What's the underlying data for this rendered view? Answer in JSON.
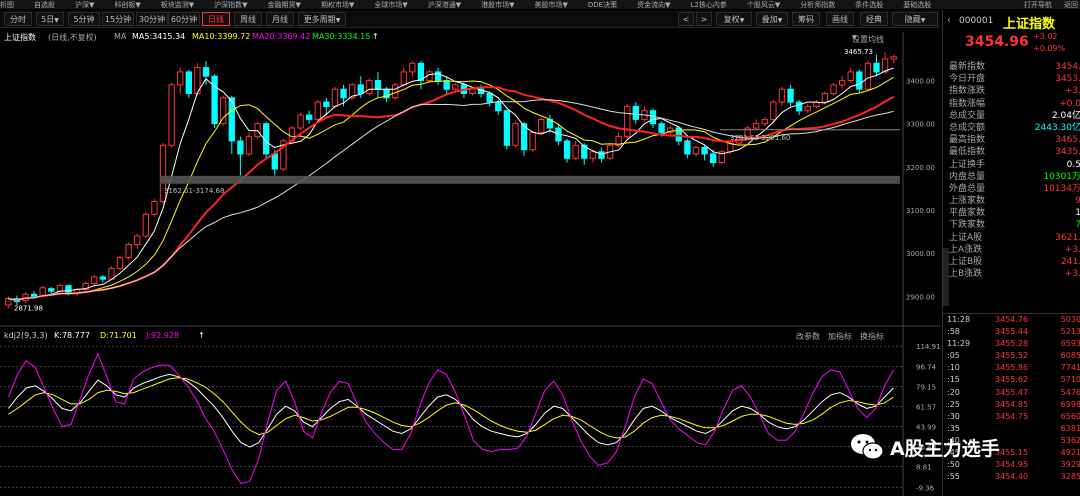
{
  "topbar": {
    "items": [
      "析图",
      "自选股",
      "沪深▼",
      "科创板▼",
      "板块监测▼",
      "沪深指数▼",
      "金融期货▼",
      "期权市场▼",
      "全球市场▼",
      "沪深港通▼",
      "港股市场▼",
      "美股市场▼",
      "DDE决策",
      "资金流向▼",
      "L2核心内参",
      "个股风云▼",
      "分析师指数",
      "条件选股",
      "基础选股"
    ],
    "right": [
      "打开导航",
      "返回"
    ]
  },
  "tabs": [
    "分时",
    "5日",
    "5分钟",
    "15分钟",
    "30分钟",
    "60分钟",
    "日线",
    "周线",
    "月线",
    "更多周期"
  ],
  "toolbar": {
    "nav_left": "<",
    "nav_right": ">",
    "restore": "复权",
    "overlay": "叠加",
    "chips": "筹码",
    "draw": "画线",
    "classic": "经典",
    "hide": "隐藏"
  },
  "panel_header": {
    "code": "000001",
    "name": "上证指数"
  },
  "quote": {
    "price": "3454.96",
    "change": "+3.02",
    "change_pct": "+0.09%"
  },
  "ma_info": {
    "name": "上证指数",
    "mode": "(日线,不复权)",
    "ma_label": "MA",
    "ma5": "MA5:3415.34",
    "ma10": "MA10:3399.72",
    "ma20": "MA20:3369.42",
    "ma30": "MA30:3334.15",
    "settings": "设置均线"
  },
  "kdj_info": {
    "name": "kdj2(9,3,3)",
    "k": "K:78.777",
    "d": "D:71.701",
    "j": "J:92.928",
    "change_params": "改参数",
    "add_indicator": "加指标",
    "switch_indicator": "换指标"
  },
  "colors": {
    "up": "#ff3333",
    "down": "#00ffff",
    "ma5": "#ffffff",
    "ma10": "#ffff00",
    "ma20": "#ff00ff",
    "ma30": "#00ff00",
    "k": "#ffffff",
    "d": "#ffff00",
    "j": "#ff00ff"
  },
  "chart_data": [
    {
      "type": "candlestick",
      "title": "上证指数",
      "y_ticks": [
        "3400.00",
        "3300.00",
        "3200.00",
        "3100.00",
        "3000.00",
        "2900.00"
      ],
      "ylim": [
        2850,
        3480
      ],
      "annotations": {
        "high": "3465.73",
        "low": "2871.98",
        "support_1": "3162.61-3174.68",
        "support_2": "3281.62-3291.60"
      },
      "candles": [
        [
          2880,
          2895,
          2872,
          2900
        ],
        [
          2895,
          2888,
          2880,
          2902
        ],
        [
          2890,
          2905,
          2885,
          2910
        ],
        [
          2905,
          2900,
          2895,
          2912
        ],
        [
          2900,
          2920,
          2898,
          2925
        ],
        [
          2918,
          2912,
          2905,
          2922
        ],
        [
          2912,
          2925,
          2908,
          2930
        ],
        [
          2925,
          2908,
          2902,
          2928
        ],
        [
          2908,
          2916,
          2900,
          2920
        ],
        [
          2916,
          2930,
          2910,
          2935
        ],
        [
          2930,
          2945,
          2925,
          2950
        ],
        [
          2945,
          2940,
          2932,
          2950
        ],
        [
          2940,
          2965,
          2938,
          2970
        ],
        [
          2965,
          2990,
          2960,
          2995
        ],
        [
          2990,
          3020,
          2985,
          3025
        ],
        [
          3020,
          3040,
          3010,
          3045
        ],
        [
          3040,
          3090,
          3035,
          3095
        ],
        [
          3090,
          3120,
          3085,
          3125
        ],
        [
          3120,
          3250,
          3115,
          3255
        ],
        [
          3250,
          3390,
          3245,
          3395
        ],
        [
          3390,
          3420,
          3370,
          3430
        ],
        [
          3420,
          3370,
          3360,
          3425
        ],
        [
          3370,
          3430,
          3365,
          3440
        ],
        [
          3430,
          3410,
          3390,
          3445
        ],
        [
          3410,
          3300,
          3290,
          3415
        ],
        [
          3300,
          3360,
          3295,
          3365
        ],
        [
          3360,
          3260,
          3230,
          3365
        ],
        [
          3260,
          3230,
          3180,
          3270
        ],
        [
          3230,
          3270,
          3225,
          3280
        ],
        [
          3270,
          3300,
          3265,
          3305
        ],
        [
          3300,
          3230,
          3220,
          3305
        ],
        [
          3230,
          3195,
          3180,
          3240
        ],
        [
          3195,
          3260,
          3190,
          3265
        ],
        [
          3260,
          3290,
          3255,
          3295
        ],
        [
          3290,
          3320,
          3285,
          3325
        ],
        [
          3320,
          3310,
          3300,
          3330
        ],
        [
          3310,
          3350,
          3305,
          3355
        ],
        [
          3350,
          3340,
          3320,
          3360
        ],
        [
          3340,
          3380,
          3335,
          3385
        ],
        [
          3380,
          3360,
          3340,
          3390
        ],
        [
          3360,
          3390,
          3355,
          3395
        ],
        [
          3390,
          3370,
          3360,
          3410
        ],
        [
          3370,
          3400,
          3365,
          3405
        ],
        [
          3400,
          3380,
          3360,
          3420
        ],
        [
          3380,
          3360,
          3350,
          3385
        ],
        [
          3360,
          3390,
          3355,
          3395
        ],
        [
          3390,
          3420,
          3385,
          3430
        ],
        [
          3420,
          3440,
          3410,
          3445
        ],
        [
          3440,
          3400,
          3380,
          3445
        ],
        [
          3400,
          3420,
          3395,
          3425
        ],
        [
          3420,
          3400,
          3390,
          3430
        ],
        [
          3400,
          3380,
          3370,
          3410
        ],
        [
          3380,
          3390,
          3375,
          3395
        ],
        [
          3390,
          3370,
          3360,
          3395
        ],
        [
          3370,
          3380,
          3365,
          3385
        ],
        [
          3380,
          3370,
          3360,
          3390
        ],
        [
          3370,
          3350,
          3340,
          3375
        ],
        [
          3350,
          3330,
          3320,
          3355
        ],
        [
          3330,
          3250,
          3240,
          3335
        ],
        [
          3250,
          3300,
          3245,
          3305
        ],
        [
          3300,
          3240,
          3225,
          3305
        ],
        [
          3240,
          3280,
          3235,
          3285
        ],
        [
          3280,
          3310,
          3275,
          3315
        ],
        [
          3310,
          3290,
          3280,
          3320
        ],
        [
          3290,
          3260,
          3250,
          3300
        ],
        [
          3260,
          3220,
          3210,
          3265
        ],
        [
          3220,
          3250,
          3215,
          3260
        ],
        [
          3250,
          3220,
          3205,
          3255
        ],
        [
          3220,
          3235,
          3210,
          3240
        ],
        [
          3235,
          3220,
          3210,
          3245
        ],
        [
          3220,
          3250,
          3215,
          3255
        ],
        [
          3250,
          3270,
          3245,
          3280
        ],
        [
          3270,
          3340,
          3265,
          3345
        ],
        [
          3340,
          3310,
          3300,
          3350
        ],
        [
          3310,
          3330,
          3305,
          3340
        ],
        [
          3330,
          3300,
          3290,
          3335
        ],
        [
          3300,
          3280,
          3270,
          3305
        ],
        [
          3280,
          3290,
          3275,
          3295
        ],
        [
          3290,
          3260,
          3250,
          3295
        ],
        [
          3260,
          3230,
          3220,
          3265
        ],
        [
          3230,
          3245,
          3225,
          3250
        ],
        [
          3245,
          3230,
          3215,
          3250
        ],
        [
          3230,
          3210,
          3200,
          3240
        ],
        [
          3210,
          3235,
          3205,
          3240
        ],
        [
          3235,
          3255,
          3230,
          3260
        ],
        [
          3255,
          3270,
          3250,
          3275
        ],
        [
          3270,
          3290,
          3265,
          3295
        ],
        [
          3290,
          3300,
          3285,
          3310
        ],
        [
          3300,
          3310,
          3295,
          3315
        ],
        [
          3310,
          3350,
          3305,
          3355
        ],
        [
          3350,
          3380,
          3340,
          3385
        ],
        [
          3380,
          3350,
          3340,
          3390
        ],
        [
          3350,
          3330,
          3320,
          3355
        ],
        [
          3330,
          3340,
          3325,
          3345
        ],
        [
          3340,
          3350,
          3335,
          3355
        ],
        [
          3350,
          3370,
          3345,
          3375
        ],
        [
          3370,
          3390,
          3365,
          3395
        ],
        [
          3390,
          3400,
          3380,
          3410
        ],
        [
          3400,
          3420,
          3395,
          3430
        ],
        [
          3420,
          3380,
          3370,
          3425
        ],
        [
          3380,
          3440,
          3375,
          3445
        ],
        [
          3440,
          3420,
          3410,
          3460
        ],
        [
          3420,
          3450,
          3415,
          3466
        ],
        [
          3450,
          3455,
          3440,
          3460
        ]
      ]
    },
    {
      "type": "line",
      "title": "kdj2(9,3,3)",
      "y_ticks": [
        "114.91",
        "96.74",
        "79.15",
        "61.57",
        "43.99",
        "26.40",
        "8.81",
        "-9.36"
      ],
      "ylim": [
        -10,
        115
      ],
      "series": [
        {
          "name": "K",
          "values": [
            60,
            70,
            78,
            80,
            75,
            68,
            60,
            58,
            65,
            75,
            85,
            80,
            72,
            70,
            78,
            82,
            85,
            88,
            90,
            88,
            84,
            78,
            70,
            62,
            52,
            40,
            30,
            26,
            30,
            42,
            55,
            62,
            58,
            48,
            44,
            52,
            60,
            66,
            68,
            62,
            55,
            50,
            45,
            40,
            38,
            42,
            52,
            62,
            70,
            72,
            68,
            60,
            50,
            44,
            40,
            38,
            36,
            35,
            38,
            46,
            56,
            62,
            60,
            52,
            44,
            36,
            30,
            28,
            30,
            38,
            50,
            60,
            62,
            58,
            52,
            48,
            44,
            40,
            38,
            42,
            50,
            58,
            62,
            60,
            55,
            48,
            44,
            42,
            44,
            50,
            58,
            66,
            72,
            74,
            70,
            64,
            60,
            62,
            70,
            78
          ]
        },
        {
          "name": "D",
          "values": [
            55,
            60,
            66,
            72,
            74,
            72,
            68,
            64,
            64,
            68,
            74,
            76,
            75,
            73,
            74,
            77,
            80,
            83,
            86,
            87,
            86,
            83,
            79,
            73,
            66,
            57,
            48,
            41,
            37,
            39,
            45,
            51,
            54,
            52,
            49,
            50,
            53,
            57,
            61,
            61,
            59,
            56,
            52,
            48,
            45,
            44,
            47,
            52,
            58,
            63,
            65,
            63,
            59,
            54,
            49,
            45,
            42,
            40,
            39,
            41,
            46,
            51,
            54,
            53,
            50,
            45,
            40,
            36,
            34,
            35,
            40,
            47,
            52,
            54,
            53,
            51,
            48,
            45,
            43,
            43,
            45,
            49,
            53,
            55,
            55,
            53,
            50,
            47,
            46,
            47,
            50,
            55,
            61,
            65,
            67,
            66,
            64,
            63,
            65,
            70
          ]
        },
        {
          "name": "J",
          "values": [
            70,
            90,
            102,
            96,
            78,
            60,
            44,
            46,
            68,
            90,
            108,
            88,
            66,
            64,
            86,
            92,
            96,
            98,
            98,
            90,
            80,
            68,
            52,
            40,
            24,
            6,
            -6,
            -4,
            16,
            48,
            76,
            84,
            66,
            40,
            34,
            56,
            74,
            84,
            82,
            64,
            48,
            38,
            30,
            24,
            24,
            38,
            62,
            82,
            94,
            90,
            74,
            54,
            32,
            24,
            22,
            24,
            24,
            25,
            36,
            56,
            76,
            84,
            72,
            50,
            32,
            18,
            10,
            12,
            22,
            44,
            70,
            86,
            82,
            66,
            50,
            42,
            36,
            30,
            28,
            40,
            60,
            76,
            80,
            70,
            55,
            38,
            32,
            32,
            40,
            56,
            74,
            88,
            94,
            92,
            76,
            60,
            52,
            60,
            80,
            94
          ]
        }
      ]
    }
  ],
  "right_stats": [
    {
      "label": "最新指数",
      "value": "3454.",
      "color": "#ff3333"
    },
    {
      "label": "今日开盘",
      "value": "3453.",
      "color": "#ff3333"
    },
    {
      "label": "指数涨跌",
      "value": "+3.",
      "color": "#ff3333"
    },
    {
      "label": "指数涨幅",
      "value": "+0.0",
      "color": "#ff3333"
    },
    {
      "label": "总成交量",
      "value": "2.04亿",
      "color": "#ffffff"
    },
    {
      "label": "总成交额",
      "value": "2443.30亿",
      "color": "#00ffff"
    },
    {
      "label": "最高指数",
      "value": "3465.",
      "color": "#ff3333"
    },
    {
      "label": "最低指数",
      "value": "3435.",
      "color": "#ff3333"
    },
    {
      "label": "上证换手",
      "value": "0.5",
      "color": "#ffffff"
    },
    {
      "label": "内盘总量",
      "value": "10301万",
      "color": "#00ff00"
    },
    {
      "label": "外盘总量",
      "value": "10134万",
      "color": "#ff3333"
    },
    {
      "label": "上涨家数",
      "value": "9",
      "color": "#ff3333"
    },
    {
      "label": "平盘家数",
      "value": "1",
      "color": "#ffffff"
    },
    {
      "label": "下跌家数",
      "value": "7",
      "color": "#00ff00"
    },
    {
      "label": "上证A股",
      "value": "3621.",
      "color": "#ff3333"
    },
    {
      "label": "上A涨跌",
      "value": "+3.",
      "color": "#ff3333"
    },
    {
      "label": "上证B股",
      "value": "241.",
      "color": "#ff3333"
    },
    {
      "label": "上B涨跌",
      "value": "+3.",
      "color": "#ff3333"
    }
  ],
  "ticks": [
    {
      "t": "11:28",
      "p": "3454.76",
      "q": "5030"
    },
    {
      "t": ":58",
      "p": "3455.44",
      "q": "5213"
    },
    {
      "t": "11:29",
      "p": "3455.28",
      "q": "6593"
    },
    {
      "t": ":05",
      "p": "3455.52",
      "q": "6085"
    },
    {
      "t": ":10",
      "p": "3455.86",
      "q": "7741"
    },
    {
      "t": ":15",
      "p": "3455.62",
      "q": "5710"
    },
    {
      "t": ":20",
      "p": "3455.47",
      "q": "5476"
    },
    {
      "t": ":25",
      "p": "3454.85",
      "q": "6998"
    },
    {
      "t": ":30",
      "p": "3454.75",
      "q": "6560"
    },
    {
      "t": ":35",
      "p": "",
      "q": "6381"
    },
    {
      "t": ":40",
      "p": "",
      "q": "5362"
    },
    {
      "t": ":45",
      "p": "3455.15",
      "q": "4921"
    },
    {
      "t": ":50",
      "p": "3454.95",
      "q": "3929"
    },
    {
      "t": ":55",
      "p": "3454.40",
      "q": "3285"
    }
  ],
  "watermark": {
    "text": "A股主力选手",
    "icon": "wechat-icon"
  }
}
